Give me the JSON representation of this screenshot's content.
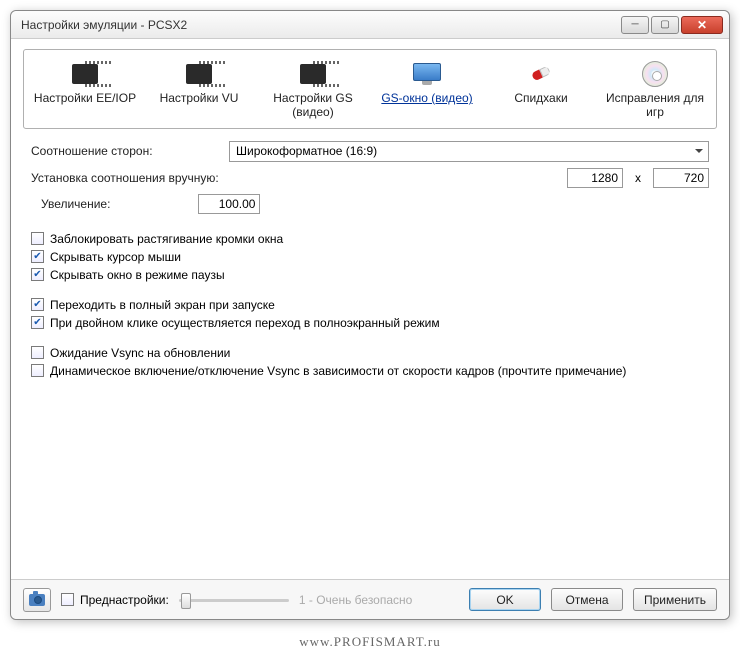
{
  "window": {
    "title": "Настройки эмуляции - PCSX2"
  },
  "tabs": [
    {
      "label": "Настройки EE/IOP"
    },
    {
      "label": "Настройки VU"
    },
    {
      "label": "Настройки GS (видео)"
    },
    {
      "label": "GS-окно (видео)"
    },
    {
      "label": "Спидхаки"
    },
    {
      "label": "Исправления для игр"
    }
  ],
  "form": {
    "aspect_label": "Соотношение сторон:",
    "aspect_value": "Широкоформатное (16:9)",
    "manual_label": "Установка соотношения вручную:",
    "manual_w": "1280",
    "manual_sep": "x",
    "manual_h": "720",
    "zoom_label": "Увеличение:",
    "zoom_value": "100.00"
  },
  "checks": {
    "lock_resize": "Заблокировать растягивание кромки окна",
    "hide_cursor": "Скрывать курсор мыши",
    "hide_pause": "Скрывать окно в режиме паузы",
    "fullscreen_start": "Переходить в полный экран при запуске",
    "dblclick_full": "При двойном клике осуществляется переход в полноэкранный режим",
    "vsync_wait": "Ожидание Vsync на обновлении",
    "vsync_dynamic": "Динамическое включение/отключение Vsync в зависимости от скорости кадров (прочтите примечание)"
  },
  "footer": {
    "presets_label": "Преднастройки:",
    "slider_text": "1 - Очень безопасно",
    "ok": "OK",
    "cancel": "Отмена",
    "apply": "Применить"
  },
  "watermark": "www.PROFISMART.ru"
}
